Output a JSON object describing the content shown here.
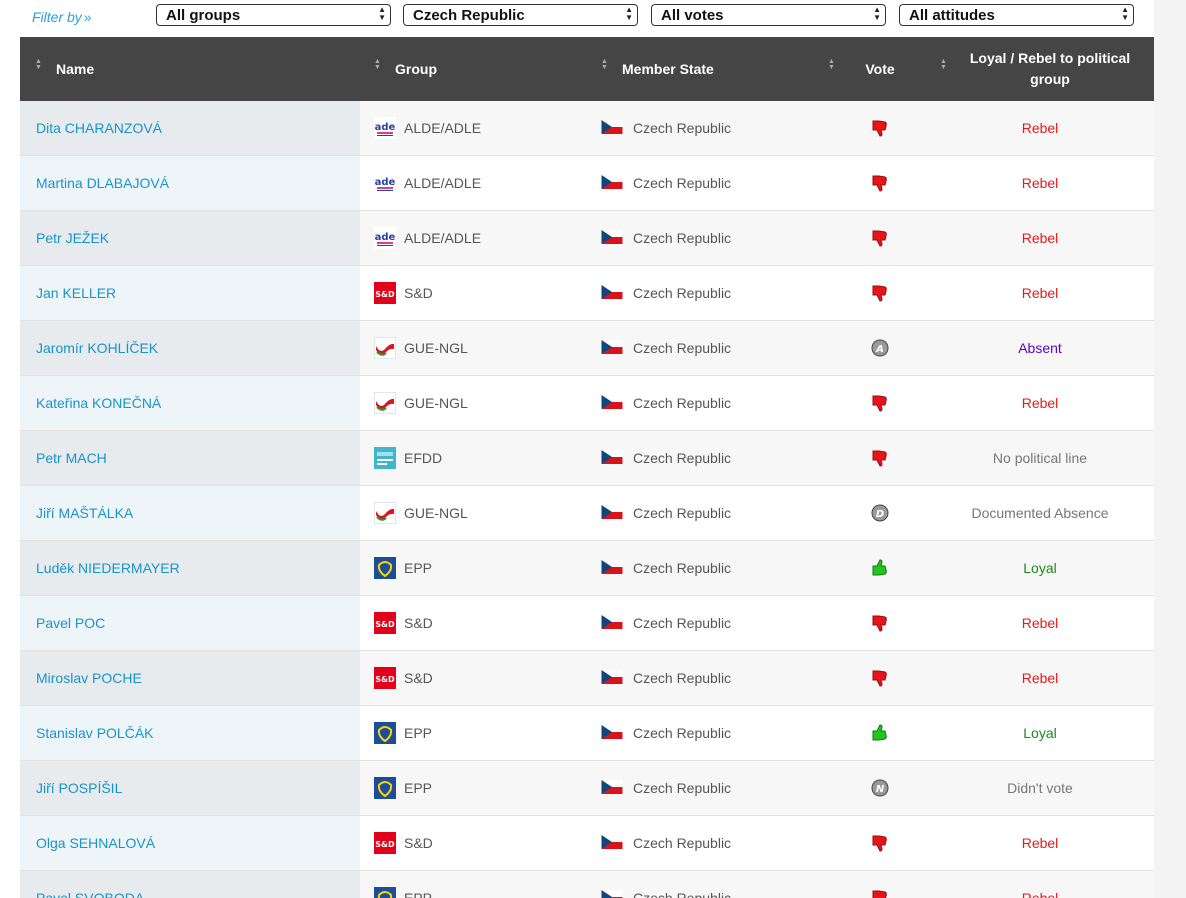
{
  "filters": {
    "label": "Filter by",
    "chevron": "»",
    "group": "All groups",
    "state": "Czech Republic",
    "votes": "All votes",
    "attitudes": "All attitudes"
  },
  "table": {
    "headers": {
      "name": "Name",
      "group": "Group",
      "state": "Member State",
      "vote": "Vote",
      "attitude": "Loyal / Rebel to political group"
    },
    "rows": [
      {
        "name": "Dita CHARANZOVÁ",
        "group": "ALDE/ADLE",
        "group_icon": "alde-logo-icon",
        "state": "Czech Republic",
        "vote_icon": "thumbs-down-icon",
        "attitude": "Rebel",
        "attitude_color": "#e51b1b"
      },
      {
        "name": "Martina DLABAJOVÁ",
        "group": "ALDE/ADLE",
        "group_icon": "alde-logo-icon",
        "state": "Czech Republic",
        "vote_icon": "thumbs-down-icon",
        "attitude": "Rebel",
        "attitude_color": "#e51b1b"
      },
      {
        "name": "Petr JEŽEK",
        "group": "ALDE/ADLE",
        "group_icon": "alde-logo-icon",
        "state": "Czech Republic",
        "vote_icon": "thumbs-down-icon",
        "attitude": "Rebel",
        "attitude_color": "#e51b1b"
      },
      {
        "name": "Jan KELLER",
        "group": "S&D",
        "group_icon": "sd-logo-icon",
        "state": "Czech Republic",
        "vote_icon": "thumbs-down-icon",
        "attitude": "Rebel",
        "attitude_color": "#e51b1b"
      },
      {
        "name": "Jaromír KOHLÍČEK",
        "group": "GUE-NGL",
        "group_icon": "gue-ngl-logo-icon",
        "state": "Czech Republic",
        "vote_icon": "absent-a-icon",
        "vote_letter": "A",
        "attitude": "Absent",
        "attitude_color": "#5c00c9"
      },
      {
        "name": "Kateřina KONEČNÁ",
        "group": "GUE-NGL",
        "group_icon": "gue-ngl-logo-icon",
        "state": "Czech Republic",
        "vote_icon": "thumbs-down-icon",
        "attitude": "Rebel",
        "attitude_color": "#e51b1b"
      },
      {
        "name": "Petr MACH",
        "group": "EFDD",
        "group_icon": "efdd-logo-icon",
        "state": "Czech Republic",
        "vote_icon": "thumbs-down-icon",
        "attitude": "No political line",
        "attitude_color": "#777777"
      },
      {
        "name": "Jiří MAŠTÁLKA",
        "group": "GUE-NGL",
        "group_icon": "gue-ngl-logo-icon",
        "state": "Czech Republic",
        "vote_icon": "documented-absence-d-icon",
        "vote_letter": "D",
        "attitude": "Documented Absence",
        "attitude_color": "#777777"
      },
      {
        "name": "Luděk NIEDERMAYER",
        "group": "EPP",
        "group_icon": "epp-logo-icon",
        "state": "Czech Republic",
        "vote_icon": "thumbs-up-icon",
        "attitude": "Loyal",
        "attitude_color": "#1a8a1a"
      },
      {
        "name": "Pavel POC",
        "group": "S&D",
        "group_icon": "sd-logo-icon",
        "state": "Czech Republic",
        "vote_icon": "thumbs-down-icon",
        "attitude": "Rebel",
        "attitude_color": "#e51b1b"
      },
      {
        "name": "Miroslav POCHE",
        "group": "S&D",
        "group_icon": "sd-logo-icon",
        "state": "Czech Republic",
        "vote_icon": "thumbs-down-icon",
        "attitude": "Rebel",
        "attitude_color": "#e51b1b"
      },
      {
        "name": "Stanislav POLČÁK",
        "group": "EPP",
        "group_icon": "epp-logo-icon",
        "state": "Czech Republic",
        "vote_icon": "thumbs-up-icon",
        "attitude": "Loyal",
        "attitude_color": "#1a8a1a"
      },
      {
        "name": "Jiří POSPÍŠIL",
        "group": "EPP",
        "group_icon": "epp-logo-icon",
        "state": "Czech Republic",
        "vote_icon": "didnt-vote-n-icon",
        "vote_letter": "N",
        "attitude": "Didn't vote",
        "attitude_color": "#777777"
      },
      {
        "name": "Olga SEHNALOVÁ",
        "group": "S&D",
        "group_icon": "sd-logo-icon",
        "state": "Czech Republic",
        "vote_icon": "thumbs-down-icon",
        "attitude": "Rebel",
        "attitude_color": "#e51b1b"
      },
      {
        "name": "Pavel SVOBODA",
        "group": "EPP",
        "group_icon": "epp-logo-icon",
        "state": "Czech Republic",
        "vote_icon": "thumbs-down-icon",
        "attitude": "Rebel",
        "attitude_color": "#e51b1b"
      }
    ]
  },
  "colors": {
    "header_bg": "#454545",
    "link": "#1a93c8",
    "thumb_down": "#e8141b",
    "thumb_up": "#22c41f"
  }
}
